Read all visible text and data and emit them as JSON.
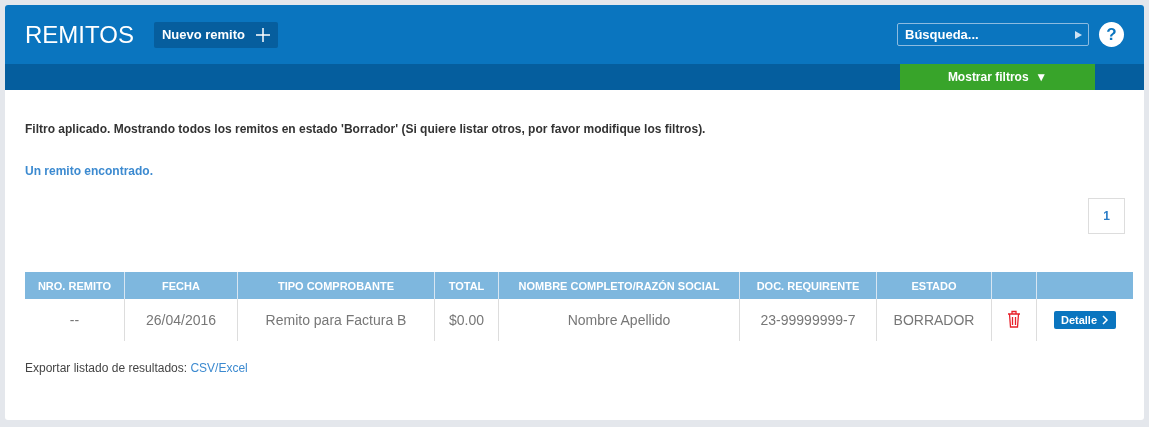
{
  "header": {
    "title": "REMITOS",
    "new_button": "Nuevo remito",
    "search": {
      "placeholder": "Búsqueda..."
    },
    "help": "?"
  },
  "filter_bar": {
    "button": "Mostrar filtros",
    "arrow": "▼"
  },
  "filter_message": "Filtro aplicado. Mostrando todos los remitos en estado 'Borrador' (Si quiere listar otros, por favor modifique los filtros).",
  "result_count": "Un remito encontrado.",
  "pagination": [
    {
      "label": "1"
    }
  ],
  "table": {
    "columns": [
      "NRO. REMITO",
      "FECHA",
      "TIPO COMPROBANTE",
      "TOTAL",
      "NOMBRE COMPLETO/RAZÓN SOCIAL",
      "DOC. REQUIRENTE",
      "ESTADO"
    ],
    "rows": [
      {
        "cells": [
          "--",
          "26/04/2016",
          "Remito para Factura B",
          "$0.00",
          "Nombre Apellido",
          "23-99999999-7",
          "BORRADOR"
        ],
        "action": "Detalle"
      }
    ]
  },
  "export": {
    "label": "Exportar listado de resultados:",
    "link": "CSV/Excel"
  }
}
